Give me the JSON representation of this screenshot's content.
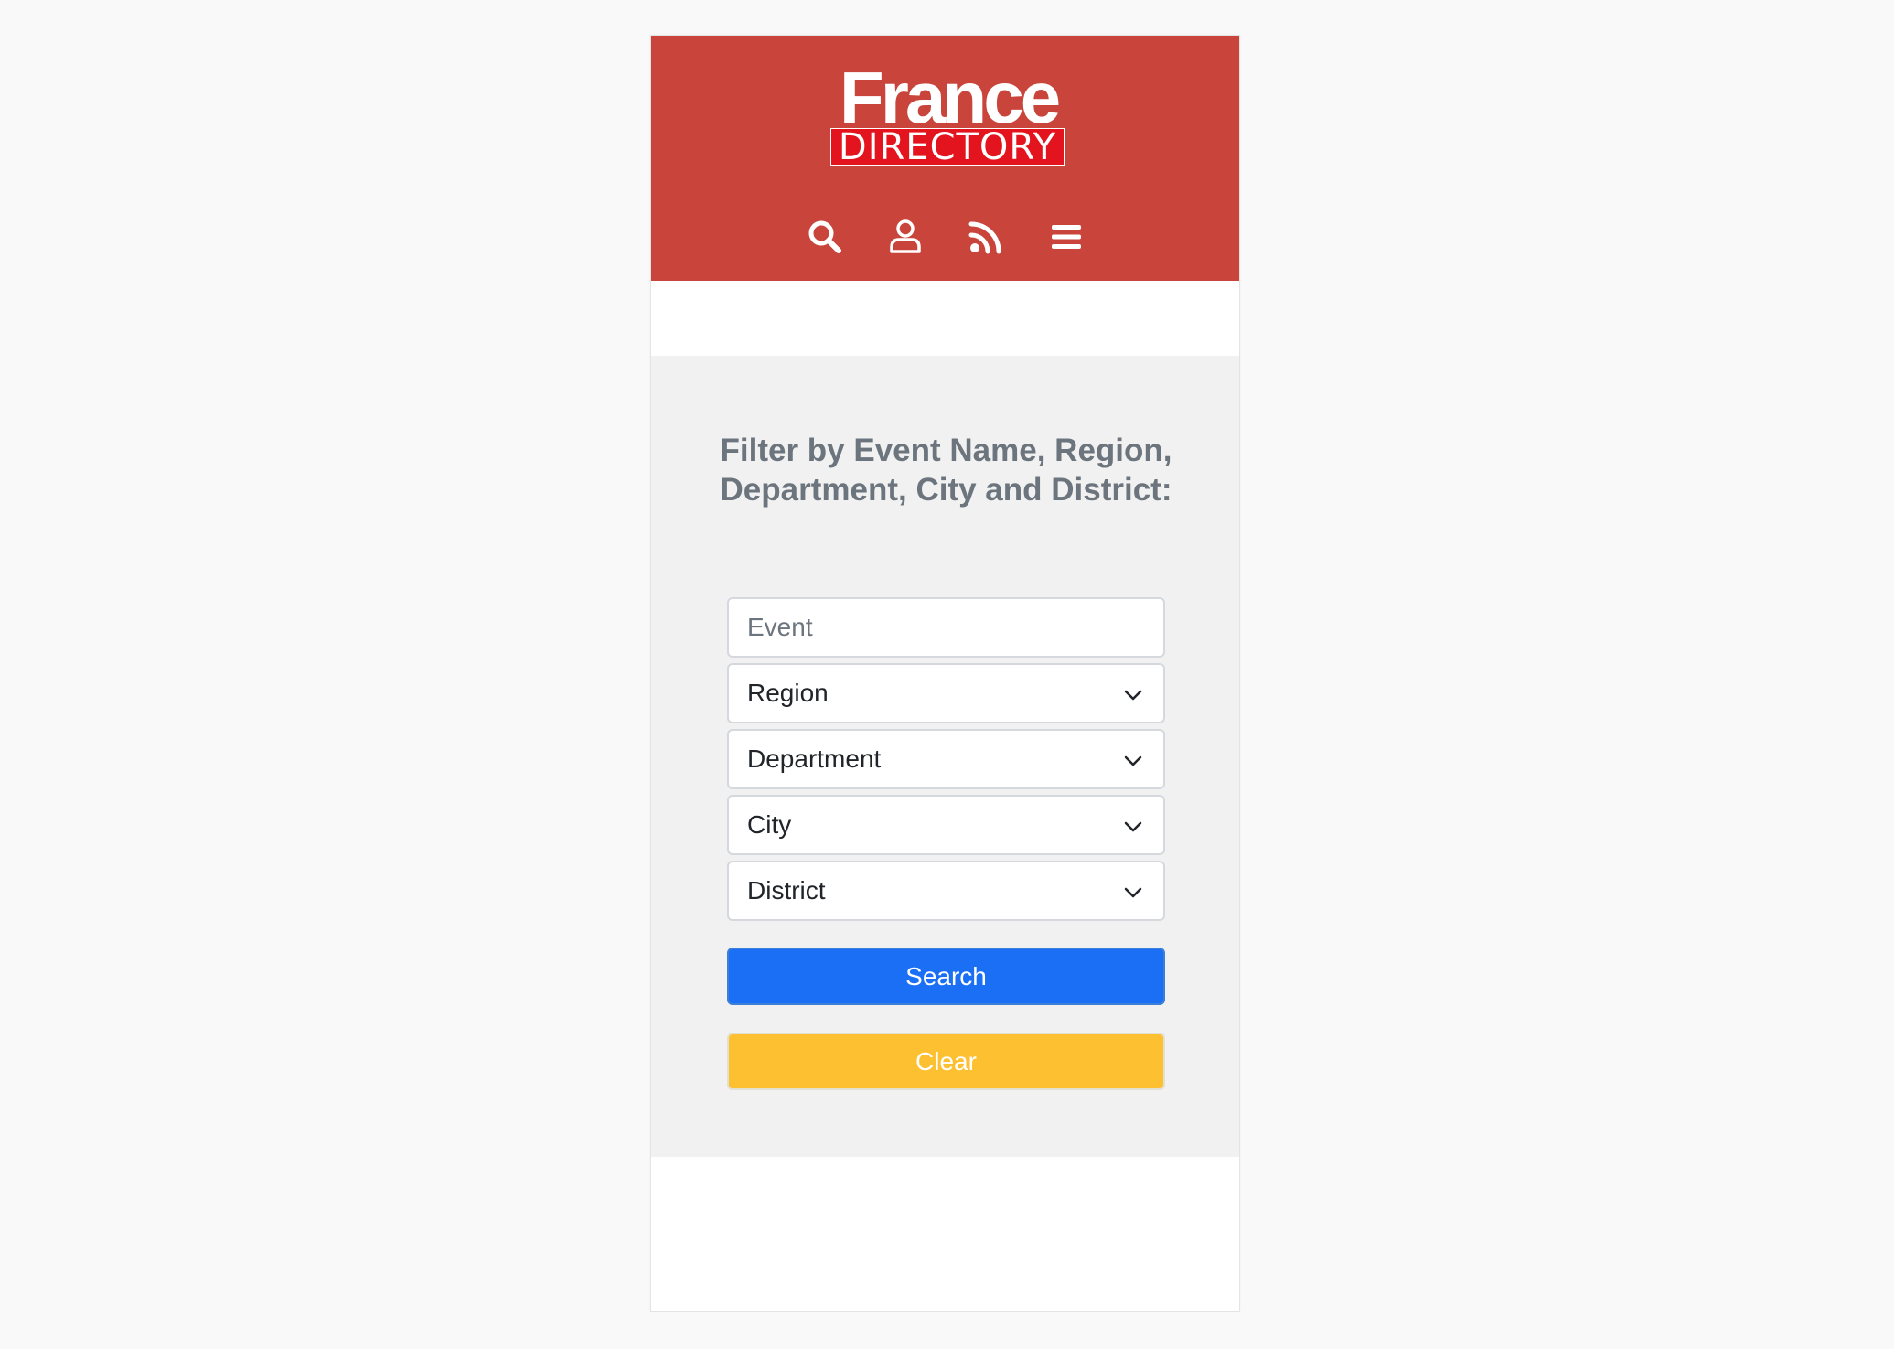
{
  "colors": {
    "header_bg": "#c9443a",
    "page_bg": "#f9f9f9",
    "filter_bg": "#f1f1f1",
    "search_button": "#1b6ff5",
    "clear_button": "#fdc030",
    "title_text": "#6c757d"
  },
  "header": {
    "logo": {
      "top_text": "France",
      "bottom_text": "DIRECTORY"
    },
    "icons": [
      {
        "name": "search-icon"
      },
      {
        "name": "user-icon"
      },
      {
        "name": "rss-icon"
      },
      {
        "name": "menu-icon"
      }
    ]
  },
  "filter": {
    "title": "Filter by Event Name, Region, Department, City and District:",
    "event_placeholder": "Event",
    "region_label": "Region",
    "department_label": "Department",
    "city_label": "City",
    "district_label": "District",
    "search_label": "Search",
    "clear_label": "Clear"
  }
}
